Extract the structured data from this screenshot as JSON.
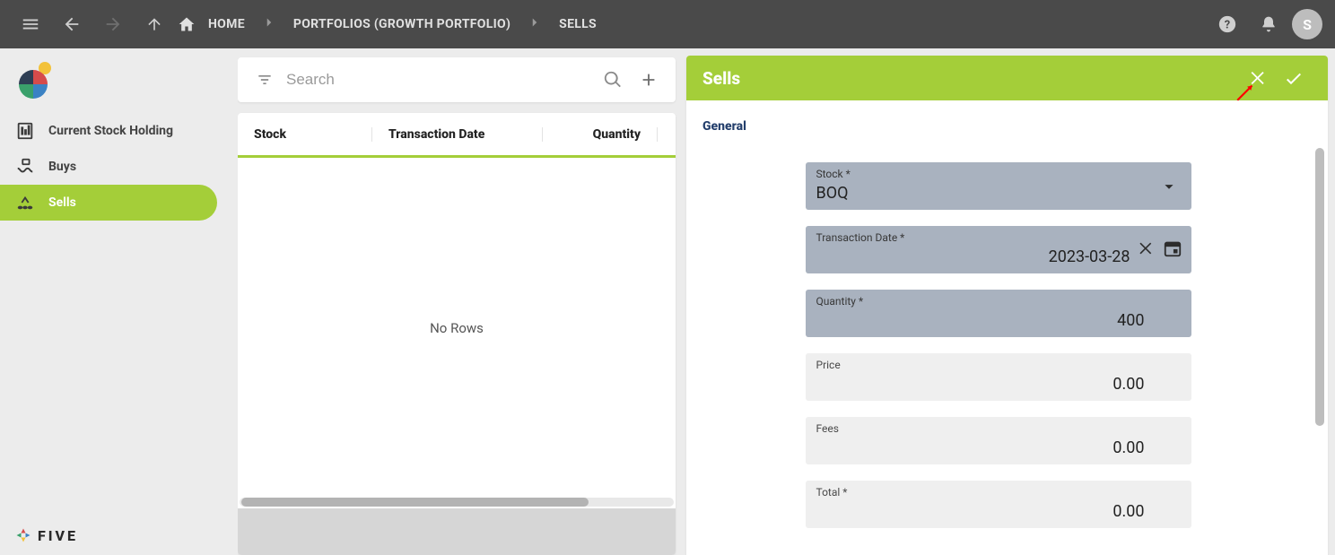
{
  "topbar": {
    "breadcrumbs": [
      {
        "label": "HOME"
      },
      {
        "label": "PORTFOLIOS (GROWTH PORTFOLIO)"
      },
      {
        "label": "SELLS"
      }
    ],
    "avatar_initial": "S"
  },
  "sidebar": {
    "items": [
      {
        "label": "Current Stock Holding",
        "active": false
      },
      {
        "label": "Buys",
        "active": false
      },
      {
        "label": "Sells",
        "active": true
      }
    ],
    "footer_brand": "FIVE"
  },
  "list": {
    "search_placeholder": "Search",
    "columns": [
      "Stock",
      "Transaction Date",
      "Quantity"
    ],
    "empty_text": "No Rows",
    "rows": []
  },
  "detail": {
    "title": "Sells",
    "tab": "General",
    "fields": {
      "stock": {
        "label": "Stock *",
        "value": "BOQ"
      },
      "txdate": {
        "label": "Transaction Date *",
        "value": "2023-03-28"
      },
      "quantity": {
        "label": "Quantity *",
        "value": "400"
      },
      "price": {
        "label": "Price",
        "value": "0.00"
      },
      "fees": {
        "label": "Fees",
        "value": "0.00"
      },
      "total": {
        "label": "Total *",
        "value": "0.00"
      }
    }
  },
  "colors": {
    "accent": "#a4ce39",
    "topbar": "#4a4a4a"
  }
}
